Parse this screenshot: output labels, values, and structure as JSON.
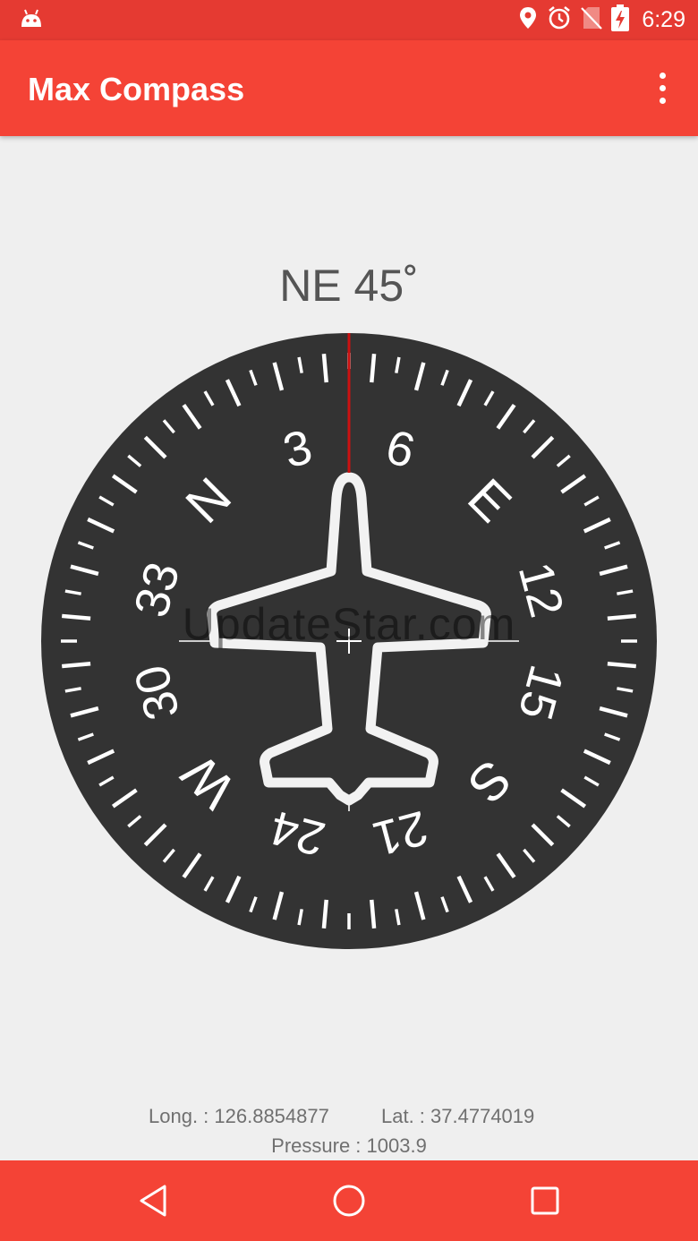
{
  "status_bar": {
    "time": "6:29",
    "icons": [
      "android-icon",
      "location-pin-icon",
      "alarm-icon",
      "no-sim-icon",
      "battery-charging-icon"
    ]
  },
  "app_bar": {
    "title": "Max Compass",
    "menu_icon": "overflow-menu-icon"
  },
  "compass": {
    "heading_text": "NE 45˚",
    "heading_degrees": 45,
    "dial_labels": [
      "N",
      "3",
      "6",
      "E",
      "12",
      "15",
      "S",
      "21",
      "24",
      "W",
      "30",
      "33"
    ],
    "watermark": "UpdateStar.com",
    "colors": {
      "dial": "#333333",
      "marks": "#ffffff",
      "needle": "#cc1111"
    }
  },
  "location": {
    "longitude": "Long. : 126.8854877",
    "latitude": "Lat. : 37.4774019",
    "pressure": "Pressure : 1003.9"
  },
  "nav_bar": {
    "icons": [
      "back-icon",
      "home-icon",
      "recents-icon"
    ]
  },
  "colors": {
    "status_bar": "#e53a32",
    "app_bar": "#f44336",
    "background": "#efefef"
  }
}
